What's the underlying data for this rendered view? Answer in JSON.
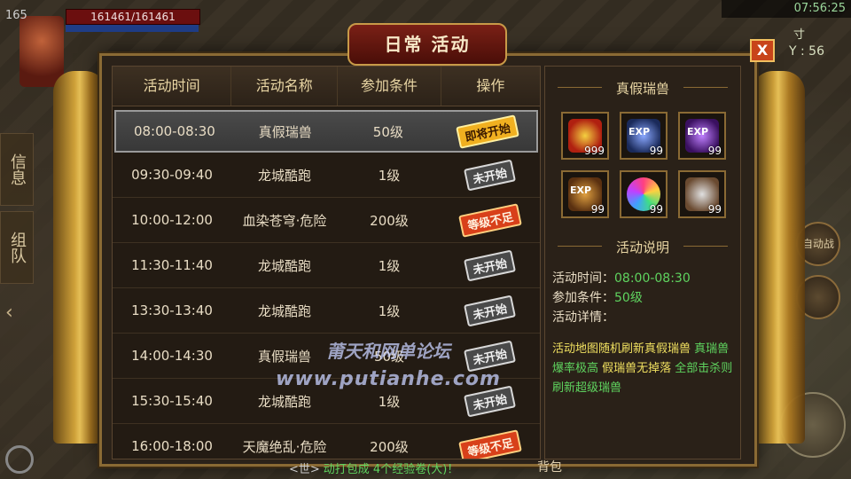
{
  "hud": {
    "level": "165",
    "hp_text": "161461/161461",
    "clock": "07:56:25",
    "coord_y": "Y : 56",
    "coord_top": "寸",
    "side_tabs": [
      "信息",
      "组队"
    ],
    "right_btn_label": "自动战斗",
    "chat_bracket": "<世>",
    "chat_text": "动打包成  4个经验卷(大)！",
    "bag_label": "背包"
  },
  "panel": {
    "title": "日常 活动",
    "close_label": "X",
    "columns": [
      "活动时间",
      "活动名称",
      "参加条件",
      "操作"
    ],
    "rows": [
      {
        "time": "08:00-08:30",
        "name": "真假瑞兽",
        "cond": "50级",
        "status": "即将开始",
        "kind": "soon"
      },
      {
        "time": "09:30-09:40",
        "name": "龙城酷跑",
        "cond": "1级",
        "status": "未开始",
        "kind": "not"
      },
      {
        "time": "10:00-12:00",
        "name": "血染苍穹·危险",
        "cond": "200级",
        "status": "等级不足",
        "kind": "lack"
      },
      {
        "time": "11:30-11:40",
        "name": "龙城酷跑",
        "cond": "1级",
        "status": "未开始",
        "kind": "not"
      },
      {
        "time": "13:30-13:40",
        "name": "龙城酷跑",
        "cond": "1级",
        "status": "未开始",
        "kind": "not"
      },
      {
        "time": "14:00-14:30",
        "name": "真假瑞兽",
        "cond": "50级",
        "status": "未开始",
        "kind": "not"
      },
      {
        "time": "15:30-15:40",
        "name": "龙城酷跑",
        "cond": "1级",
        "status": "未开始",
        "kind": "not"
      },
      {
        "time": "16:00-18:00",
        "name": "天魔绝乱·危险",
        "cond": "200级",
        "status": "等级不足",
        "kind": "lack"
      }
    ]
  },
  "info": {
    "reward_title": "真假瑞兽",
    "rewards": [
      {
        "icon": "gold",
        "qty": "999",
        "exp": ""
      },
      {
        "icon": "expb",
        "qty": "99",
        "exp": "EXP"
      },
      {
        "icon": "expp",
        "qty": "99",
        "exp": "EXP"
      },
      {
        "icon": "expg",
        "qty": "99",
        "exp": "EXP"
      },
      {
        "icon": "orb",
        "qty": "99",
        "exp": ""
      },
      {
        "icon": "ore",
        "qty": "99",
        "exp": ""
      }
    ],
    "desc_title": "活动说明",
    "time_label": "活动时间：",
    "time_value": "08:00-08:30",
    "cond_label": "参加条件：",
    "cond_value": "50级",
    "detail_label": "活动详情：",
    "detail_yellow1": "活动地图随机刷新真假瑞兽 ",
    "detail_green1": "真瑞兽爆率极高",
    "detail_yellow2": " 假瑞兽无掉落 ",
    "detail_green2": "全部击杀则刷新超级瑞兽"
  },
  "watermark": {
    "line1": "莆天和网单论坛",
    "line2": "www.putianhe.com"
  }
}
